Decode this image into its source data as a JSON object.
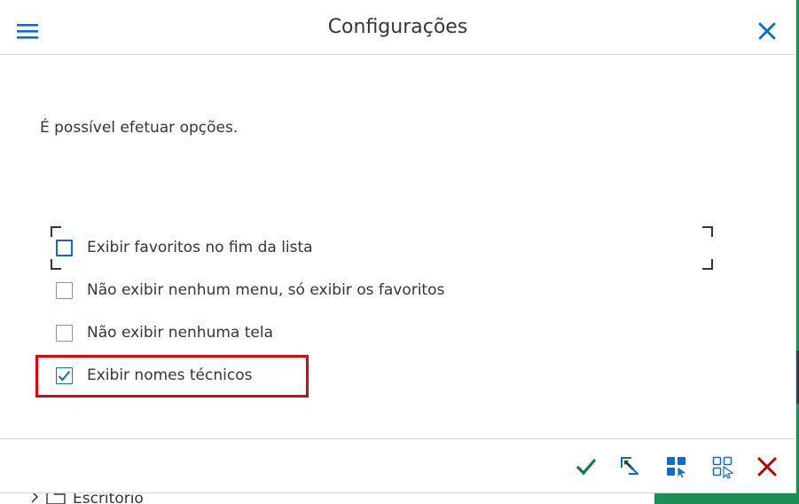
{
  "dialog": {
    "title": "Configurações",
    "message": "É possível efetuar opções.",
    "options": [
      {
        "label": "Exibir favoritos no fim da lista",
        "checked": false,
        "focused": true
      },
      {
        "label": "Não exibir nenhum menu, só exibir os favoritos",
        "checked": false
      },
      {
        "label": "Não exibir nenhuma tela",
        "checked": false
      },
      {
        "label": "Exibir nomes técnicos",
        "checked": true,
        "highlighted": true
      }
    ],
    "footer_icons": [
      "checkmark-icon",
      "cursor-select-icon",
      "select-all-icon",
      "deselect-all-icon",
      "cancel-icon"
    ]
  },
  "background": {
    "tree_item": "Escritório"
  },
  "colors": {
    "accent": "#0a6ed1",
    "confirm": "#107e3e",
    "cancel": "#bb0000",
    "highlight": "#e8000b",
    "side_panel": "#1e8e57"
  }
}
